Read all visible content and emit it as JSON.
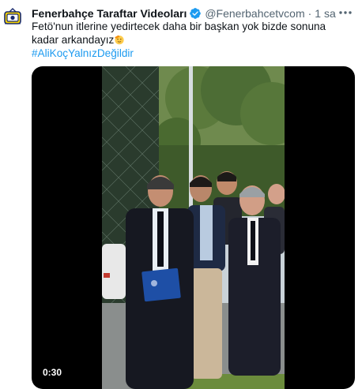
{
  "tweet": {
    "author_name": "Fenerbahçe Taraftar Videoları",
    "handle": "@Fenerbahcetvcom",
    "separator": "·",
    "time": "1 sa",
    "text": "Fetö'nun itlerine yedirtecek daha bir başkan yok bizde sonuna kadar arkandayız",
    "hashtag": "#AliKoçYalnızDeğildir",
    "icons": {
      "avatar": "fenerbahce-tv-logo",
      "verified": "verified-badge-icon",
      "more": "more-options-icon",
      "emoji": "saluting-face-emoji"
    }
  },
  "video": {
    "duration": "0:30"
  },
  "colors": {
    "link": "#1d9bf0",
    "verified": "#1d9bf0",
    "secondary_text": "#536471"
  }
}
